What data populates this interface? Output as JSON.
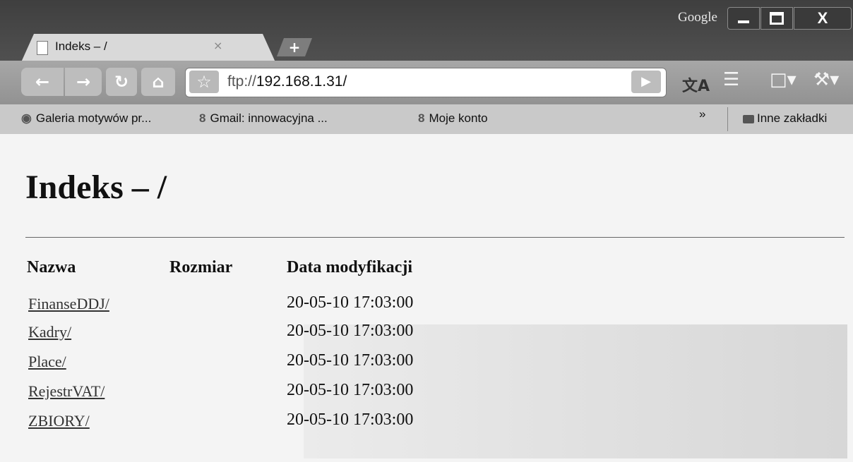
{
  "window": {
    "brand": "Google",
    "minimize": "",
    "maximize": "",
    "close": "X"
  },
  "tab": {
    "title": "Indeks – /",
    "close": "×",
    "new_tab": "+"
  },
  "toolbar": {
    "url_scheme": "ftp://",
    "url_host": "192.168.1.31/"
  },
  "bookmarks": {
    "items": [
      {
        "label": "Galeria motywów pr...",
        "icon": "globe-icon"
      },
      {
        "label": "Gmail: innowacyjna ...",
        "icon": "google-icon"
      },
      {
        "label": "Moje konto",
        "icon": "google-icon"
      }
    ],
    "more": "»",
    "other": "Inne zakładki"
  },
  "page": {
    "title": "Indeks – /",
    "columns": {
      "name": "Nazwa",
      "size": "Rozmiar",
      "date": "Data modyfikacji"
    },
    "rows": [
      {
        "name": "FinanseDDJ/",
        "size": "",
        "date": "20-05-10 17:03:00"
      },
      {
        "name": "Kadry/",
        "size": "",
        "date": "20-05-10 17:03:00"
      },
      {
        "name": "Place/",
        "size": "",
        "date": "20-05-10 17:03:00"
      },
      {
        "name": "RejestrVAT/",
        "size": "",
        "date": "20-05-10 17:03:00"
      },
      {
        "name": "ZBIORY/",
        "size": "",
        "date": "20-05-10 17:03:00"
      }
    ]
  }
}
